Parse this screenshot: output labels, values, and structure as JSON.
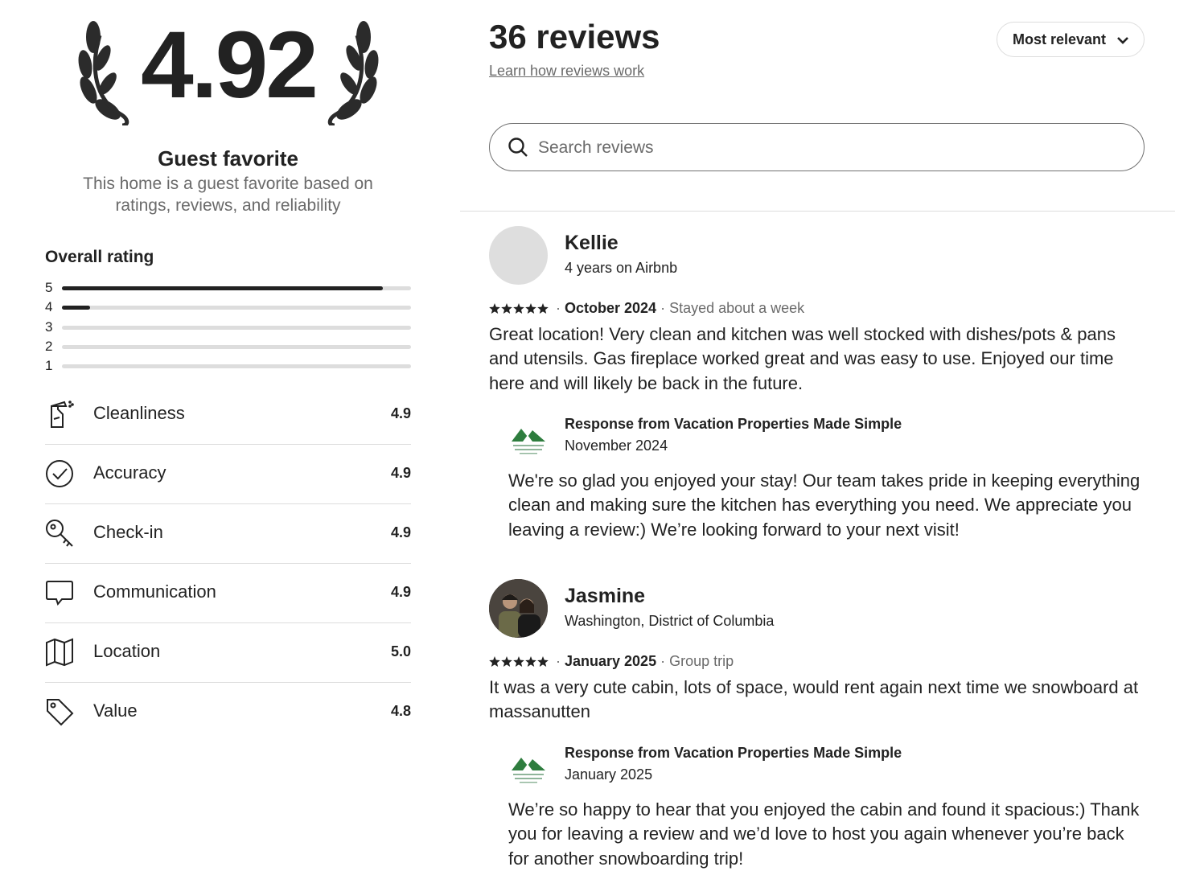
{
  "summary": {
    "score": "4.92",
    "guest_favorite_title": "Guest favorite",
    "guest_favorite_desc": "This home is a guest favorite based on ratings, reviews, and reliability"
  },
  "overall": {
    "title": "Overall rating",
    "bars": [
      {
        "label": "5",
        "fraction": 0.92
      },
      {
        "label": "4",
        "fraction": 0.08
      },
      {
        "label": "3",
        "fraction": 0
      },
      {
        "label": "2",
        "fraction": 0
      },
      {
        "label": "1",
        "fraction": 0
      }
    ]
  },
  "categories": [
    {
      "name": "Cleanliness",
      "value": "4.9",
      "icon": "spray-bottle-icon"
    },
    {
      "name": "Accuracy",
      "value": "4.9",
      "icon": "check-circle-icon"
    },
    {
      "name": "Check-in",
      "value": "4.9",
      "icon": "key-icon"
    },
    {
      "name": "Communication",
      "value": "4.9",
      "icon": "chat-bubble-icon"
    },
    {
      "name": "Location",
      "value": "5.0",
      "icon": "map-icon"
    },
    {
      "name": "Value",
      "value": "4.8",
      "icon": "tag-icon"
    }
  ],
  "header": {
    "count": "36 reviews",
    "learn_link": "Learn how reviews work",
    "sort_label": "Most relevant",
    "search_placeholder": "Search reviews"
  },
  "reviews": [
    {
      "name": "Kellie",
      "subtitle": "4 years on Airbnb",
      "rating": 5,
      "date": "October 2024",
      "trip": "Stayed about a week",
      "text": "Great location! Very clean and kitchen was well stocked with dishes/pots & pans and utensils. Gas fireplace worked great and was easy to use. Enjoyed our time here and will likely be back in the future.",
      "response": {
        "title": "Response from Vacation Properties Made Simple",
        "date": "November 2024",
        "text": "We're so glad you enjoyed your stay! Our team takes pride in keeping everything clean and making sure the kitchen has everything you need. We appreciate you leaving a review:) We’re looking forward to your next visit!"
      }
    },
    {
      "name": "Jasmine",
      "subtitle": "Washington, District of Columbia",
      "rating": 5,
      "date": "January 2025",
      "trip": "Group trip",
      "text": "It was a very cute cabin, lots of space, would rent again next time we snowboard at massanutten",
      "response": {
        "title": "Response from Vacation Properties Made Simple",
        "date": "January 2025",
        "text": "We’re so happy to hear that you enjoyed the cabin and found it spacious:) Thank you for leaving a review and we’d love to host you again whenever you’re back for another snowboarding trip!"
      }
    }
  ],
  "colors": {
    "text": "#222222",
    "muted": "#6a6a6a",
    "divider": "#dddddd",
    "logo_green": "#2e7d3e"
  }
}
